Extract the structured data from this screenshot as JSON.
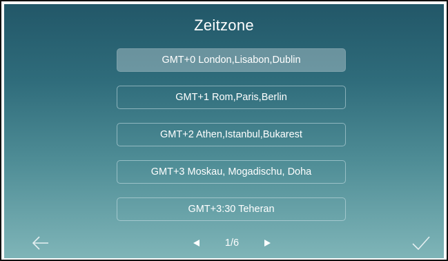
{
  "header": {
    "title": "Zeitzone"
  },
  "timezones": [
    {
      "label": "GMT+0 London,Lisabon,Dublin",
      "selected": true
    },
    {
      "label": "GMT+1 Rom,Paris,Berlin",
      "selected": false
    },
    {
      "label": "GMT+2 Athen,Istanbul,Bukarest",
      "selected": false
    },
    {
      "label": "GMT+3 Moskau, Mogadischu, Doha",
      "selected": false
    },
    {
      "label": "GMT+3:30 Teheran",
      "selected": false
    }
  ],
  "pagination": {
    "indicator": "1/6",
    "current_page": 1,
    "total_pages": 6
  },
  "icons": {
    "back": "back-arrow-icon",
    "confirm": "checkmark-icon",
    "prev": "triangle-left-icon",
    "next": "triangle-right-icon"
  },
  "colors": {
    "background_top": "#225768",
    "background_bottom": "#7fb5b8",
    "text": "#ffffff",
    "selected_fill": "#e1ebee"
  }
}
